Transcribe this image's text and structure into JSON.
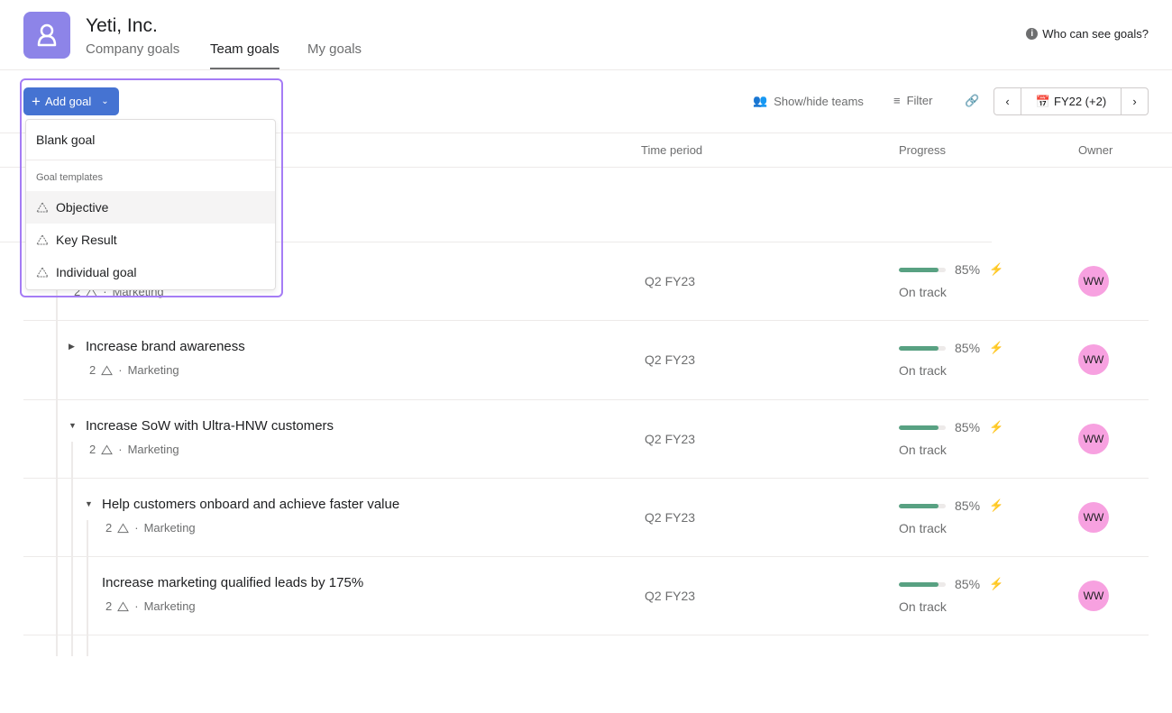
{
  "header": {
    "org_name": "Yeti, Inc.",
    "tabs": [
      {
        "label": "Company goals"
      },
      {
        "label": "Team goals",
        "active": true
      },
      {
        "label": "My goals"
      }
    ],
    "who_can_see": "Who can see goals?"
  },
  "toolbar": {
    "add_goal": "Add goal",
    "show_hide_teams": "Show/hide teams",
    "filter": "Filter",
    "period": "FY22 (+2)"
  },
  "add_goal_menu": {
    "blank_goal": "Blank goal",
    "templates_heading": "Goal templates",
    "templates": [
      "Objective",
      "Key Result",
      "Individual goal"
    ]
  },
  "columns": {
    "time_period": "Time period",
    "progress": "Progress",
    "owner": "Owner"
  },
  "colors": {
    "accent": "#4573d2",
    "logo": "#8d84e8",
    "progress": "#58a182",
    "avatar": "#f7a1e0",
    "highlight": "#a57cf5"
  },
  "goals": [
    {
      "title": "",
      "subgoals": "2",
      "team": "Marketing",
      "period": "Q2 FY23",
      "progress_pct": 85,
      "progress_label": "85%",
      "status": "On track",
      "owner": "WW"
    },
    {
      "title": "Increase brand awareness",
      "subgoals": "2",
      "team": "Marketing",
      "period": "Q2 FY23",
      "progress_pct": 85,
      "progress_label": "85%",
      "status": "On track",
      "owner": "WW"
    },
    {
      "title": "Increase SoW with Ultra-HNW customers",
      "subgoals": "2",
      "team": "Marketing",
      "period": "Q2 FY23",
      "progress_pct": 85,
      "progress_label": "85%",
      "status": "On track",
      "owner": "WW"
    },
    {
      "title": "Help customers onboard and achieve faster value",
      "subgoals": "2",
      "team": "Marketing",
      "period": "Q2 FY23",
      "progress_pct": 85,
      "progress_label": "85%",
      "status": "On track",
      "owner": "WW"
    },
    {
      "title": "Increase marketing qualified leads by 175%",
      "subgoals": "2",
      "team": "Marketing",
      "period": "Q2 FY23",
      "progress_pct": 85,
      "progress_label": "85%",
      "status": "On track",
      "owner": "WW"
    }
  ]
}
